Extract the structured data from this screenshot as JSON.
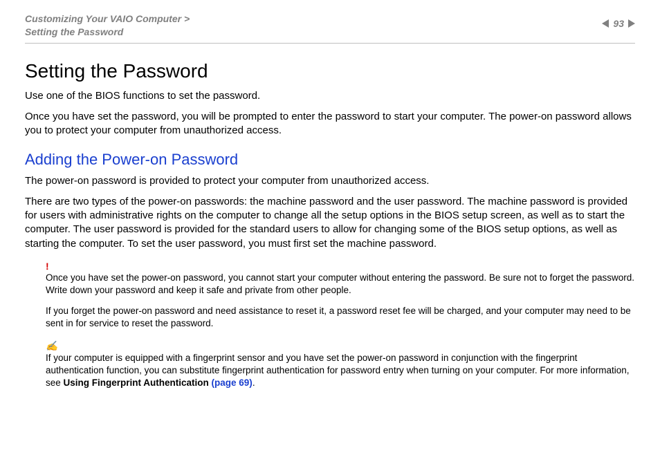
{
  "header": {
    "breadcrumb_line1": "Customizing Your VAIO Computer >",
    "breadcrumb_line2": "Setting the Password",
    "page_number": "93"
  },
  "title": "Setting the Password",
  "intro_p1": "Use one of the BIOS functions to set the password.",
  "intro_p2": "Once you have set the password, you will be prompted to enter the password to start your computer. The power-on password allows you to protect your computer from unauthorized access.",
  "section_heading": "Adding the Power-on Password",
  "section_p1": "The power-on password is provided to protect your computer from unauthorized access.",
  "section_p2": "There are two types of the power-on passwords: the machine password and the user password. The machine password is provided for users with administrative rights on the computer to change all the setup options in the BIOS setup screen, as well as to start the computer. The user password is provided for the standard users to allow for changing some of the BIOS setup options, as well as starting the computer. To set the user password, you must first set the machine password.",
  "warn_mark": "!",
  "warn_p1": "Once you have set the power-on password, you cannot start your computer without entering the password. Be sure not to forget the password. Write down your password and keep it safe and private from other people.",
  "warn_p2": "If you forget the power-on password and need assistance to reset it, a password reset fee will be charged, and your computer may need to be sent in for service to reset the password.",
  "tip_mark": "✍",
  "tip_text_pre": "If your computer is equipped with a fingerprint sensor and you have set the power-on password in conjunction with the fingerprint authentication function, you can substitute fingerprint authentication for password entry when turning on your computer. For more information, see ",
  "tip_bold": "Using Fingerprint Authentication ",
  "tip_link": "(page 69)",
  "tip_text_post": "."
}
